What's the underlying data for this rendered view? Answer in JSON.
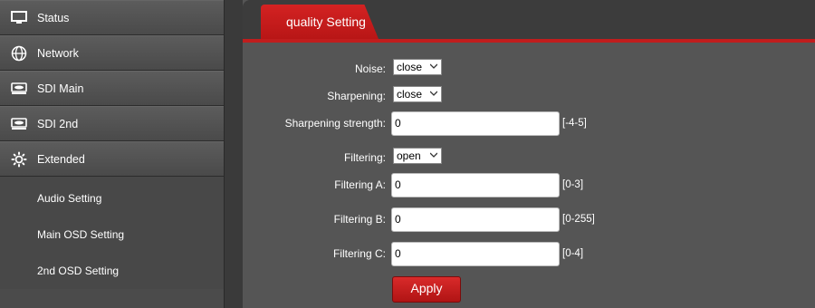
{
  "sidebar": {
    "items": [
      {
        "label": "Status",
        "icon": "monitor-icon"
      },
      {
        "label": "Network",
        "icon": "globe-icon"
      },
      {
        "label": "SDI Main",
        "icon": "disk-icon"
      },
      {
        "label": "SDI 2nd",
        "icon": "disk-icon"
      },
      {
        "label": "Extended",
        "icon": "gear-icon"
      }
    ],
    "sub_items": [
      "Audio Setting",
      "Main OSD Setting",
      "2nd OSD Setting"
    ]
  },
  "tab": {
    "label": "quality Setting"
  },
  "form": {
    "noise": {
      "label": "Noise",
      "value": "close"
    },
    "sharpening": {
      "label": "Sharpening",
      "value": "close"
    },
    "sharpening_strength": {
      "label": "Sharpening strength",
      "value": "0",
      "range": "[-4-5]"
    },
    "filtering": {
      "label": "Filtering",
      "value": "open"
    },
    "filtering_a": {
      "label": "Filtering A",
      "value": "0",
      "range": "[0-3]"
    },
    "filtering_b": {
      "label": "Filtering B",
      "value": "0",
      "range": "[0-255]"
    },
    "filtering_c": {
      "label": "Filtering C",
      "value": "0",
      "range": "[0-4]"
    },
    "apply_label": "Apply",
    "colon": ":"
  },
  "colors": {
    "accent": "#c01d1d",
    "background": "#555555",
    "sidebar": "#4b4b4b"
  }
}
